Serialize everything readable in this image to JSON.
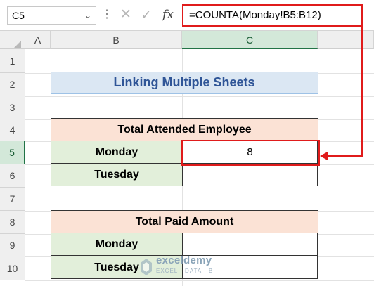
{
  "formula_bar": {
    "name_box": "C5",
    "name_box_dropdown_icon": "chevron-down-icon",
    "more_icon": "vertical-dots-icon",
    "cancel_icon": "cross-icon",
    "enter_icon": "check-icon",
    "fx_label": "fx",
    "formula": "=COUNTA(Monday!B5:B12)"
  },
  "columns": [
    "A",
    "B",
    "C"
  ],
  "selected_column": "C",
  "rows": [
    "1",
    "2",
    "3",
    "4",
    "5",
    "6",
    "7",
    "8",
    "9",
    "10"
  ],
  "selected_row": "5",
  "sheet": {
    "title": "Linking Multiple Sheets",
    "table1": {
      "header": "Total Attended Employee",
      "rows": [
        {
          "day": "Monday",
          "value": "8"
        },
        {
          "day": "Tuesday",
          "value": ""
        }
      ]
    },
    "table2": {
      "header": "Total Paid Amount",
      "rows": [
        {
          "day": "Monday",
          "value": ""
        },
        {
          "day": "Tuesday",
          "value": ""
        }
      ]
    }
  },
  "watermark": {
    "brand": "exceldemy",
    "tagline": "EXCEL · DATA · BI"
  },
  "colors": {
    "highlight_red": "#e01b1b",
    "title_fill": "#dbe7f3",
    "title_text": "#2f5597",
    "header_fill": "#fbe2d5",
    "day_fill": "#e2efda",
    "selected_header": "#d3e8d9"
  }
}
